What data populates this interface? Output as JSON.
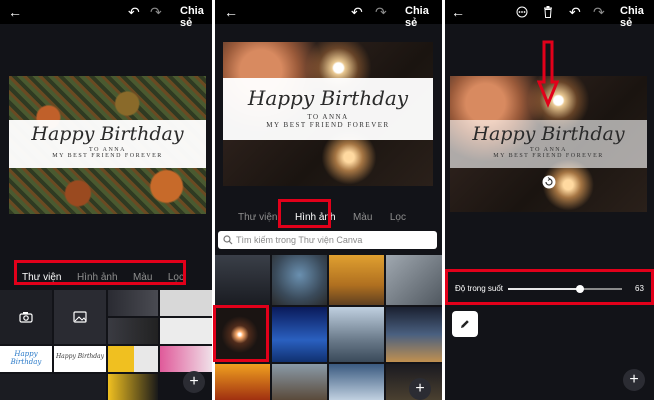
{
  "toolbar": {
    "share_label": "Chia sẻ"
  },
  "card": {
    "title": "Happy Birthday",
    "line1": "TO ANNA",
    "line2": "MY BEST FRIEND FOREVER"
  },
  "tabs": [
    {
      "label": "Thư viện"
    },
    {
      "label": "Hình ảnh"
    },
    {
      "label": "Màu"
    },
    {
      "label": "Lọc"
    }
  ],
  "search": {
    "placeholder": "Tìm kiếm trong Thư viện Canva"
  },
  "transparency": {
    "label": "Độ trong suốt",
    "value": "63",
    "fraction": 0.63
  },
  "thumbnails": {
    "mini_title": "Happy Birthday",
    "mini_label": "Happy Birthday"
  },
  "colors": {
    "highlight": "#e2001a",
    "background": "#121318"
  }
}
